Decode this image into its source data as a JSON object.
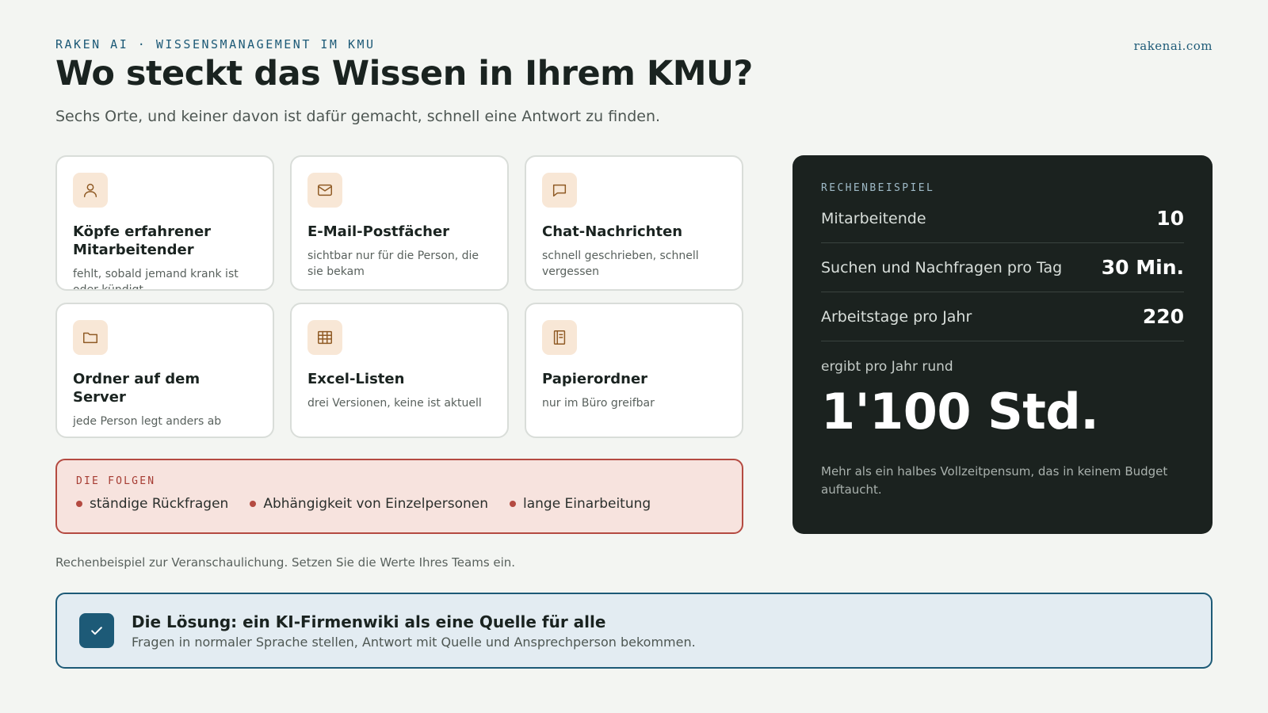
{
  "header": {
    "eyebrow": "RAKEN AI · WISSENSMANAGEMENT IM KMU",
    "site": "rakenai.com",
    "title": "Wo steckt das Wissen in Ihrem KMU?",
    "subtitle": "Sechs Orte, und keiner davon ist dafür gemacht, schnell eine Antwort zu finden."
  },
  "cards": [
    {
      "icon": "person-icon",
      "title": "Köpfe erfahrener Mitarbeitender",
      "text": "fehlt, sobald jemand krank ist oder kündigt"
    },
    {
      "icon": "mail-icon",
      "title": "E-Mail-Postfächer",
      "text": "sichtbar nur für die Person, die sie bekam"
    },
    {
      "icon": "chat-icon",
      "title": "Chat-Nachrichten",
      "text": "schnell geschrieben, schnell vergessen"
    },
    {
      "icon": "folder-icon",
      "title": "Ordner auf dem Server",
      "text": "jede Person legt anders ab"
    },
    {
      "icon": "table-icon",
      "title": "Excel-Listen",
      "text": "drei Versionen, keine ist aktuell"
    },
    {
      "icon": "document-icon",
      "title": "Papierordner",
      "text": "nur im Büro greifbar"
    }
  ],
  "consequences": {
    "label": "DIE FOLGEN",
    "items": [
      "ständige Rückfragen",
      "Abhängigkeit von Einzelpersonen",
      "lange Einarbeitung"
    ]
  },
  "note": "Rechenbeispiel zur Veranschaulichung. Setzen Sie die Werte Ihres Teams ein.",
  "calculation": {
    "label": "RECHENBEISPIEL",
    "rows": [
      {
        "label": "Mitarbeitende",
        "value": "10"
      },
      {
        "label": "Suchen und Nachfragen pro Tag",
        "value": "30 Min."
      },
      {
        "label": "Arbeitstage pro Jahr",
        "value": "220"
      }
    ],
    "result_label": "ergibt pro Jahr rund",
    "result_value": "1'100 Std.",
    "result_note": "Mehr als ein halbes Vollzeitpensum, das in keinem Budget auftaucht."
  },
  "solution": {
    "icon": "check-icon",
    "title": "Die Lösung: ein KI-Firmenwiki als eine Quelle für alle",
    "subtitle": "Fragen in normaler Sprache stellen, Antwort mit Quelle und Ansprechperson bekommen."
  },
  "colors": {
    "background": "#f3f5f2",
    "accent_blue": "#1d5a77",
    "accent_red": "#b44a41",
    "icon_bg": "#f8e7d6",
    "dark_panel": "#1b221f"
  }
}
